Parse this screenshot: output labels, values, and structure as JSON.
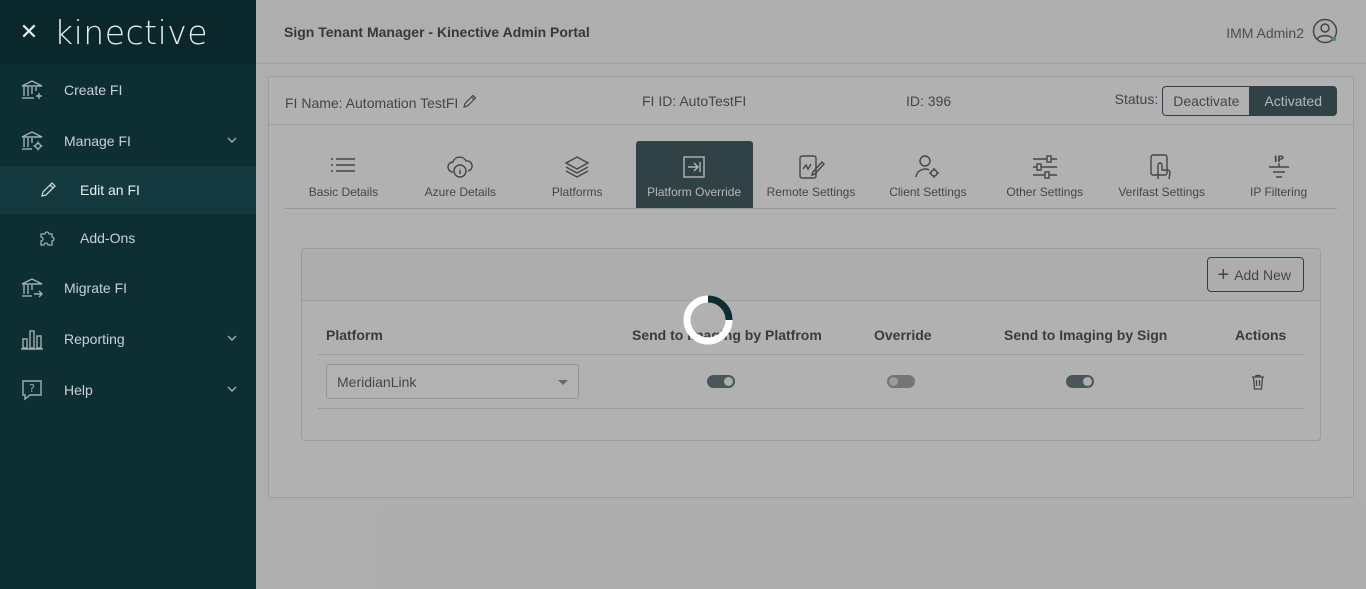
{
  "sidebar": {
    "logo": "kinective",
    "items": [
      {
        "label": "Create FI",
        "icon": "bank-plus-icon"
      },
      {
        "label": "Manage FI",
        "icon": "bank-gear-icon",
        "expanded": true
      },
      {
        "label": "Edit an FI",
        "icon": "pencil-icon",
        "active": true
      },
      {
        "label": "Add-Ons",
        "icon": "puzzle-icon"
      },
      {
        "label": "Migrate FI",
        "icon": "bank-arrow-icon"
      },
      {
        "label": "Reporting",
        "icon": "bar-chart-icon"
      },
      {
        "label": "Help",
        "icon": "help-bubble-icon"
      }
    ]
  },
  "header": {
    "title": "Sign Tenant Manager - Kinective Admin Portal",
    "user": "IMM Admin2"
  },
  "fi": {
    "name": "FI Name: Automation TestFI",
    "fi_id": "FI ID: AutoTestFI",
    "id": "ID: 396",
    "status_label": "Status:",
    "deactivate": "Deactivate",
    "activated": "Activated"
  },
  "tabs": [
    {
      "label": "Basic Details",
      "icon": "list-icon"
    },
    {
      "label": "Azure Details",
      "icon": "cloud-info-icon"
    },
    {
      "label": "Platforms",
      "icon": "layers-icon"
    },
    {
      "label": "Platform Override",
      "icon": "override-arrow-icon",
      "active": true
    },
    {
      "label": "Remote Settings",
      "icon": "tablet-sign-icon"
    },
    {
      "label": "Client Settings",
      "icon": "user-gear-icon"
    },
    {
      "label": "Other Settings",
      "icon": "sliders-icon"
    },
    {
      "label": "Verifast Settings",
      "icon": "hand-tap-icon"
    },
    {
      "label": "IP Filtering",
      "icon": "ip-filter-icon"
    }
  ],
  "panel": {
    "add_new": "Add New",
    "columns": [
      "Platform",
      "Send to Imaging by Platfrom",
      "Override",
      "Send to Imaging by Sign",
      "Actions"
    ],
    "rows": [
      {
        "platform": "MeridianLink",
        "send_by_platform": true,
        "override": false,
        "send_by_sign": true
      }
    ]
  },
  "colors": {
    "sidebar": "#0d2e33",
    "accent": "#3fb58b",
    "active_tab": "#0d2e33"
  },
  "overlay": {
    "loading": true
  }
}
